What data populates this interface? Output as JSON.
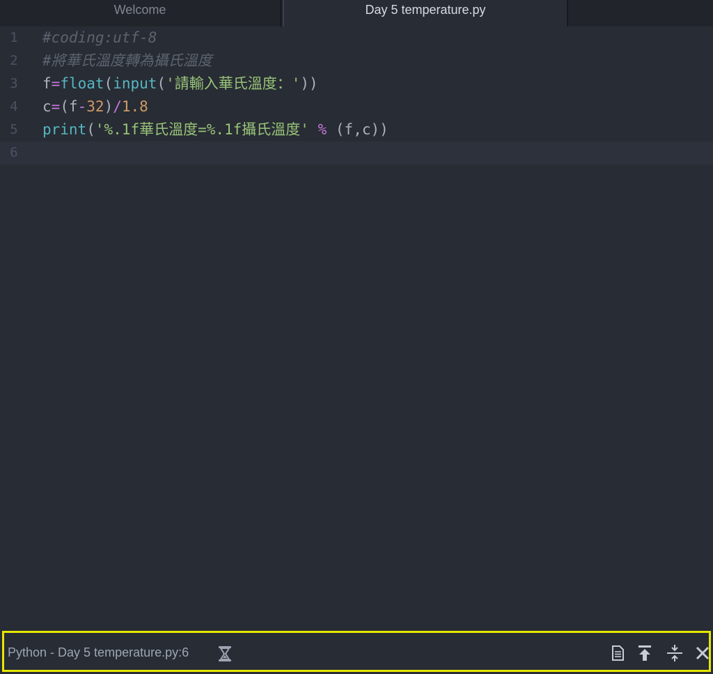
{
  "tabs": [
    {
      "label": "Welcome",
      "active": false
    },
    {
      "label": "Day 5 temperature.py",
      "active": true
    }
  ],
  "editor": {
    "line_numbers": [
      "1",
      "2",
      "3",
      "4",
      "5",
      "6"
    ],
    "lines": [
      [
        {
          "t": "#coding:utf-8",
          "c": "comment"
        }
      ],
      [
        {
          "t": "#將華氏溫度轉為攝氏溫度",
          "c": "comment"
        }
      ],
      [
        {
          "t": "f",
          "c": "txt"
        },
        {
          "t": "=",
          "c": "kw"
        },
        {
          "t": "float",
          "c": "fn"
        },
        {
          "t": "(",
          "c": "txt"
        },
        {
          "t": "input",
          "c": "fn"
        },
        {
          "t": "(",
          "c": "txt"
        },
        {
          "t": "'請輸入華氏溫度：'",
          "c": "str"
        },
        {
          "t": "))",
          "c": "txt"
        }
      ],
      [
        {
          "t": "c",
          "c": "txt"
        },
        {
          "t": "=",
          "c": "kw"
        },
        {
          "t": "(f",
          "c": "txt"
        },
        {
          "t": "-",
          "c": "kw"
        },
        {
          "t": "32",
          "c": "num"
        },
        {
          "t": ")",
          "c": "txt"
        },
        {
          "t": "/",
          "c": "kw"
        },
        {
          "t": "1.8",
          "c": "num"
        }
      ],
      [
        {
          "t": "print",
          "c": "fn"
        },
        {
          "t": "(",
          "c": "txt"
        },
        {
          "t": "'%.1f華氏溫度=%.1f攝氏溫度'",
          "c": "str"
        },
        {
          "t": " ",
          "c": "txt"
        },
        {
          "t": "%",
          "c": "kw"
        },
        {
          "t": " (f,c))",
          "c": "txt"
        }
      ],
      []
    ],
    "cursor_line": 6
  },
  "statusbar": {
    "text": "Python - Day 5 temperature.py:6",
    "icons": [
      "hourglass-icon",
      "document-icon",
      "scroll-to-top-icon",
      "collapse-icon",
      "close-icon"
    ]
  }
}
